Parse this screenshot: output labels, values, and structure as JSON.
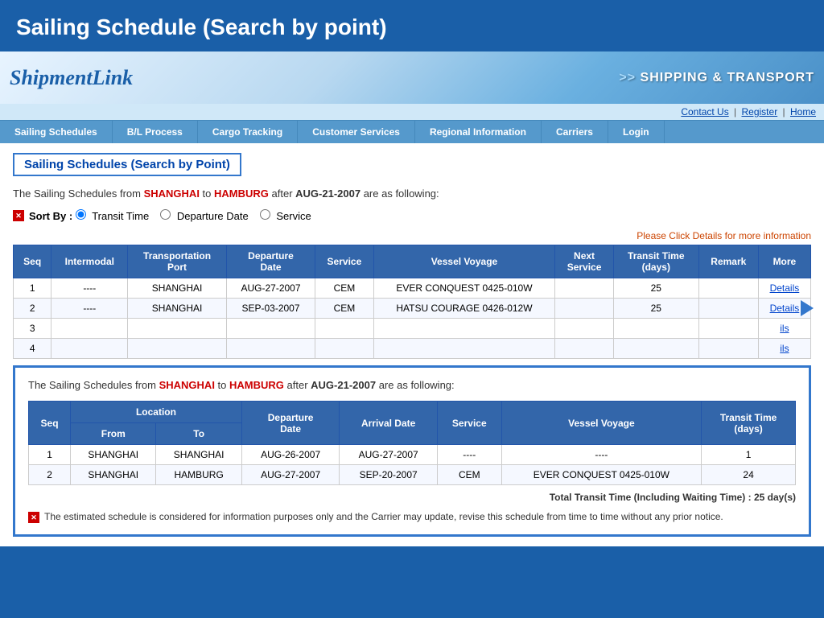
{
  "titleBar": {
    "title": "Sailing Schedule (Search by point)"
  },
  "header": {
    "logoText": "ShipmentLink",
    "shippingTransport": "SHIPPING & TRANSPORT",
    "topLinks": [
      "Contact Us",
      "Register",
      "Home"
    ],
    "nav": [
      {
        "label": "Sailing Schedules"
      },
      {
        "label": "B/L Process"
      },
      {
        "label": "Cargo Tracking"
      },
      {
        "label": "Customer Services"
      },
      {
        "label": "Regional Information"
      },
      {
        "label": "Carriers"
      },
      {
        "label": "Login"
      }
    ]
  },
  "main": {
    "pageTitle": "Sailing Schedules (Search by Point)",
    "scheduleIntro": {
      "prefix": "The Sailing Schedules from ",
      "fromCity": "SHANGHAI",
      "to": " to ",
      "toCity": "HAMBURG",
      "after": " after ",
      "date": "AUG-21-2007",
      "suffix": " are as following:"
    },
    "sortBar": {
      "label": "Sort By :",
      "options": [
        "Transit Time",
        "Departure Date",
        "Service"
      ]
    },
    "clickHint": "Please Click Details for more information",
    "table": {
      "headers": [
        "Seq",
        "Intermodal",
        "Transportation Port",
        "Departure Date",
        "Service",
        "Vessel Voyage",
        "Next Service",
        "Transit Time (days)",
        "Remark",
        "More"
      ],
      "rows": [
        {
          "seq": "1",
          "intermodal": "----",
          "port": "SHANGHAI",
          "depDate": "AUG-27-2007",
          "service": "CEM",
          "vessel": "EVER CONQUEST 0425-010W",
          "nextService": "",
          "transitTime": "25",
          "remark": "",
          "more": "Details"
        },
        {
          "seq": "2",
          "intermodal": "----",
          "port": "SHANGHAI",
          "depDate": "SEP-03-2007",
          "service": "CEM",
          "vessel": "HATSU COURAGE 0426-012W",
          "nextService": "",
          "transitTime": "25",
          "remark": "",
          "more": "Details"
        },
        {
          "seq": "3",
          "intermodal": "",
          "port": "",
          "depDate": "",
          "service": "",
          "vessel": "",
          "nextService": "",
          "transitTime": "",
          "remark": "",
          "more": "ils"
        },
        {
          "seq": "4",
          "intermodal": "",
          "port": "",
          "depDate": "",
          "service": "",
          "vessel": "",
          "nextService": "",
          "transitTime": "",
          "remark": "",
          "more": "ils"
        }
      ]
    }
  },
  "popup": {
    "intro": {
      "prefix": "The Sailing Schedules from ",
      "fromCity": "SHANGHAI",
      "to": " to ",
      "toCity": "HAMBURG",
      "after": " after ",
      "date": "AUG-21-2007",
      "suffix": " are as following:"
    },
    "table": {
      "headers": {
        "seq": "Seq",
        "locationFrom": "From",
        "locationTo": "To",
        "departureDate": "Departure Date",
        "arrivalDate": "Arrival Date",
        "service": "Service",
        "vesselVoyage": "Vessel Voyage",
        "transitTime": "Transit Time (days)"
      },
      "rows": [
        {
          "seq": "1",
          "from": "SHANGHAI",
          "to": "SHANGHAI",
          "depDate": "AUG-26-2007",
          "arrDate": "AUG-27-2007",
          "service": "----",
          "vessel": "----",
          "transitTime": "1"
        },
        {
          "seq": "2",
          "from": "SHANGHAI",
          "to": "HAMBURG",
          "depDate": "AUG-27-2007",
          "arrDate": "SEP-20-2007",
          "service": "CEM",
          "vessel": "EVER CONQUEST 0425-010W",
          "transitTime": "24"
        }
      ]
    },
    "totalTransit": "Total Transit Time (Including Waiting Time) : 25 day(s)",
    "disclaimer": "The estimated schedule is considered for information purposes only and the Carrier may update, revise this schedule from time to time without any prior notice."
  }
}
